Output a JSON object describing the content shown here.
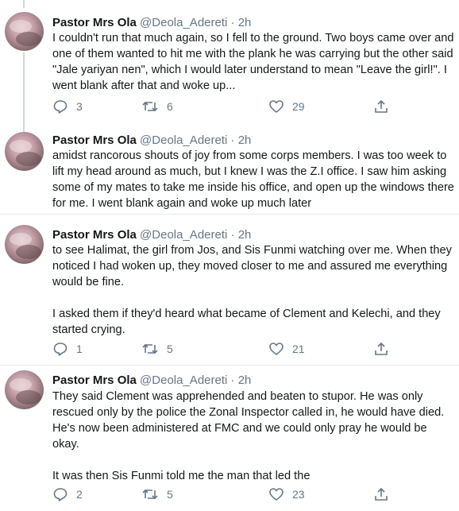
{
  "tweets": [
    {
      "name": "Pastor Mrs Ola",
      "handle": "@Deola_Adereti",
      "dot": "·",
      "time": "2h",
      "text": "I couldn't run that much again, so I fell to the ground. Two boys came over and one of them wanted to hit me with the plank he was carrying but the other said \"Jale yariyan nen\", which I would later understand to mean \"Leave the girl!\". I went blank after that and woke up...",
      "replies": "3",
      "retweets": "6",
      "likes": "29"
    },
    {
      "name": "Pastor Mrs Ola",
      "handle": "@Deola_Adereti",
      "dot": "·",
      "time": "2h",
      "text": "amidst rancorous shouts of joy from some corps members. I was too week to lift my head around as much, but I knew I was the Z.I office. I saw him asking some of my mates to take me inside his office, and open up the windows there for me. I went blank again and woke up much later"
    },
    {
      "name": "Pastor Mrs Ola",
      "handle": "@Deola_Adereti",
      "dot": "·",
      "time": "2h",
      "text": "to see Halimat, the girl from Jos, and Sis Funmi watching over me. When they noticed I had woken up, they moved closer to me and assured me everything would be fine.\n\nI asked them if they'd heard what became of Clement and Kelechi, and they started crying.",
      "replies": "1",
      "retweets": "5",
      "likes": "21"
    },
    {
      "name": "Pastor Mrs Ola",
      "handle": "@Deola_Adereti",
      "dot": "·",
      "time": "2h",
      "text": "They said Clement was apprehended and beaten to stupor. He was only rescued only by the police the Zonal Inspector called in, he would have died. He's now been administered at FMC and we could only pray he would be okay.\n\nIt was then Sis Funmi told me the man that led the",
      "replies": "2",
      "retweets": "5",
      "likes": "23"
    }
  ],
  "icons": {
    "reply": "reply-icon",
    "retweet": "retweet-icon",
    "like": "heart-icon",
    "share": "share-icon"
  },
  "colors": {
    "text": "#14171a",
    "secondary": "#657786",
    "divider": "#e6ecf0",
    "thread_line": "#ccd6dd"
  }
}
